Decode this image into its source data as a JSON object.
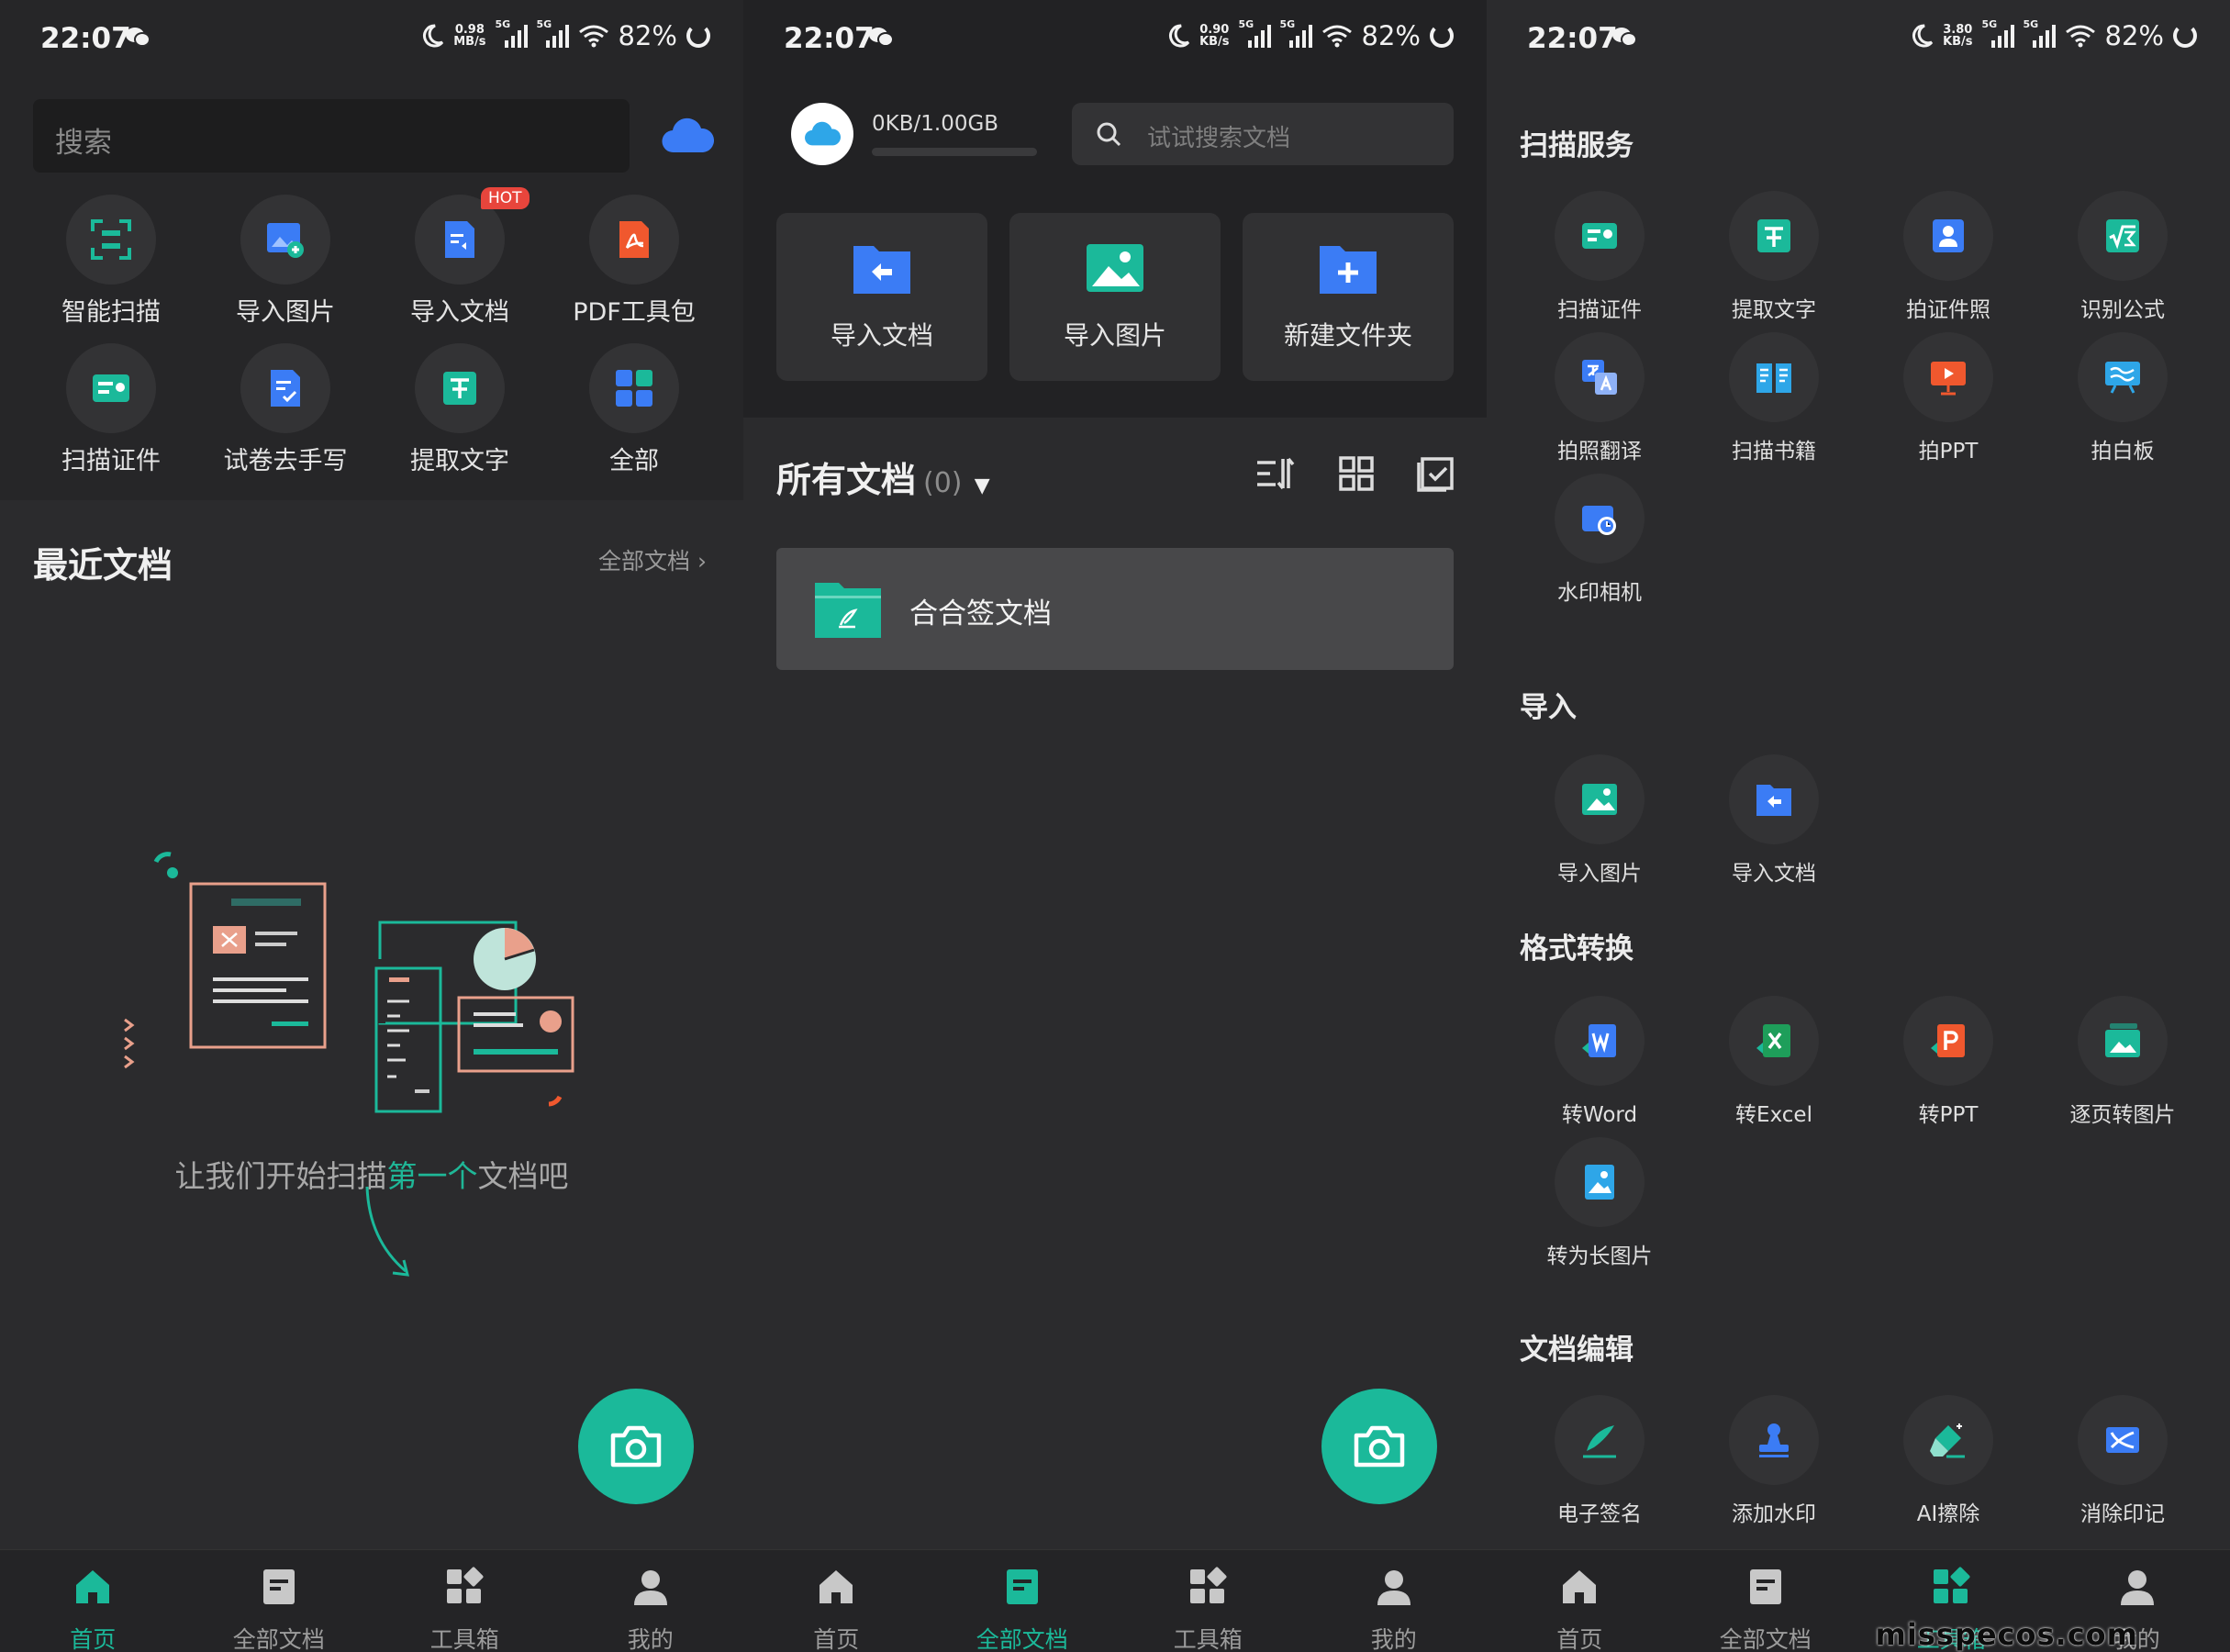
{
  "status": {
    "p1": {
      "time": "22:07",
      "speed": "0.98",
      "speed_unit": "MB/s",
      "battery": "82%"
    },
    "p2": {
      "time": "22:07",
      "speed": "0.90",
      "speed_unit": "KB/s",
      "battery": "82%"
    },
    "p3": {
      "time": "22:07",
      "speed": "3.80",
      "speed_unit": "KB/s",
      "battery": "82%"
    },
    "net_label": "5G"
  },
  "home": {
    "search_placeholder": "搜索",
    "shortcuts": [
      {
        "label": "智能扫描",
        "icon": "smart-scan-icon"
      },
      {
        "label": "导入图片",
        "icon": "import-image-icon"
      },
      {
        "label": "导入文档",
        "icon": "import-doc-icon",
        "badge": "HOT"
      },
      {
        "label": "PDF工具包",
        "icon": "pdf-toolkit-icon"
      },
      {
        "label": "扫描证件",
        "icon": "id-scan-icon"
      },
      {
        "label": "试卷去手写",
        "icon": "remove-handwriting-icon"
      },
      {
        "label": "提取文字",
        "icon": "extract-text-icon"
      },
      {
        "label": "全部",
        "icon": "all-tools-icon"
      }
    ],
    "recent_title": "最近文档",
    "all_docs_link": "全部文档",
    "empty_prefix": "让我们开始扫描",
    "empty_highlight": "第一个",
    "empty_suffix": "文档吧"
  },
  "docs": {
    "quota": "0KB/1.00GB",
    "search_placeholder": "试试搜索文档",
    "cards": [
      "导入文档",
      "导入图片",
      "新建文件夹"
    ],
    "section_title": "所有文档",
    "count": "(0)",
    "folder_name": "合合签文档"
  },
  "tools": {
    "sections": [
      {
        "title": "扫描服务",
        "items": [
          "扫描证件",
          "提取文字",
          "拍证件照",
          "识别公式",
          "拍照翻译",
          "扫描书籍",
          "拍PPT",
          "拍白板",
          "水印相机"
        ]
      },
      {
        "title": "导入",
        "items": [
          "导入图片",
          "导入文档"
        ]
      },
      {
        "title": "格式转换",
        "items": [
          "转Word",
          "转Excel",
          "转PPT",
          "逐页转图片",
          "转为长图片"
        ]
      },
      {
        "title": "文档编辑",
        "items": [
          "电子签名",
          "添加水印",
          "AI擦除",
          "消除印记"
        ]
      }
    ]
  },
  "nav": [
    "首页",
    "全部文档",
    "工具箱",
    "我的"
  ],
  "nav_active": {
    "p1": 0,
    "p2": 1,
    "p3": 2
  },
  "watermark": "misspecos.com",
  "colors": {
    "accent": "#1bb99a",
    "hot": "#e8453c",
    "blue": "#3b7cf5"
  }
}
